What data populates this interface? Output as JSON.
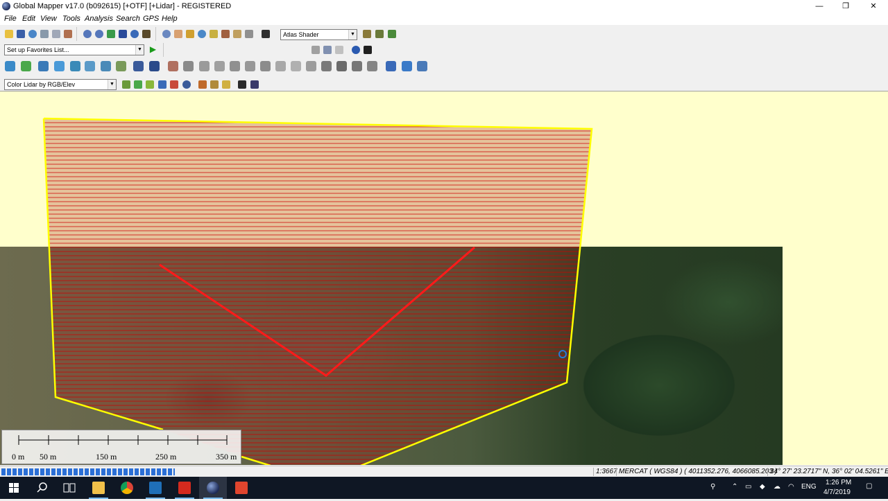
{
  "window": {
    "title": "Global Mapper v17.0 (b092615) [+OTF] [+Lidar] - REGISTERED",
    "minimize_glyph": "—",
    "maximize_glyph": "❐",
    "close_glyph": "✕"
  },
  "menu": [
    "File",
    "Edit",
    "View",
    "Tools",
    "Analysis",
    "Search",
    "GPS",
    "Help"
  ],
  "toolbar": {
    "shader_select": "Atlas Shader",
    "favorites_select": "Set up Favorites List...",
    "lidar_color_select": "Color Lidar by RGB/Elev",
    "dropdown_glyph": "▼",
    "run_glyph": "▶"
  },
  "map": {
    "scale_labels": [
      "0 m",
      "50 m",
      "150 m",
      "250 m",
      "350 m"
    ],
    "colors": {
      "background": "#ffffcc",
      "boundary": "#ffff00",
      "hatch": "#cc0000",
      "route": "#ff1a1a"
    }
  },
  "status": {
    "scale": "1:3667",
    "projection": "MERCAT ( WGS84 ) ( 4011352.276, 4066085.203 )",
    "latlon": "34° 27' 23.2717\" N, 36° 02' 04.5261\" E",
    "progress_fraction": 0.2
  },
  "taskbar": {
    "lang": "ENG",
    "time": "1:26 PM",
    "date": "4/7/2019",
    "apps": [
      "start-icon",
      "search-icon",
      "task-view-icon",
      "file-explorer-icon",
      "chrome-icon",
      "autodesk-a-icon",
      "acrobat-icon",
      "global-mapper-icon",
      "autocad-icon"
    ]
  }
}
